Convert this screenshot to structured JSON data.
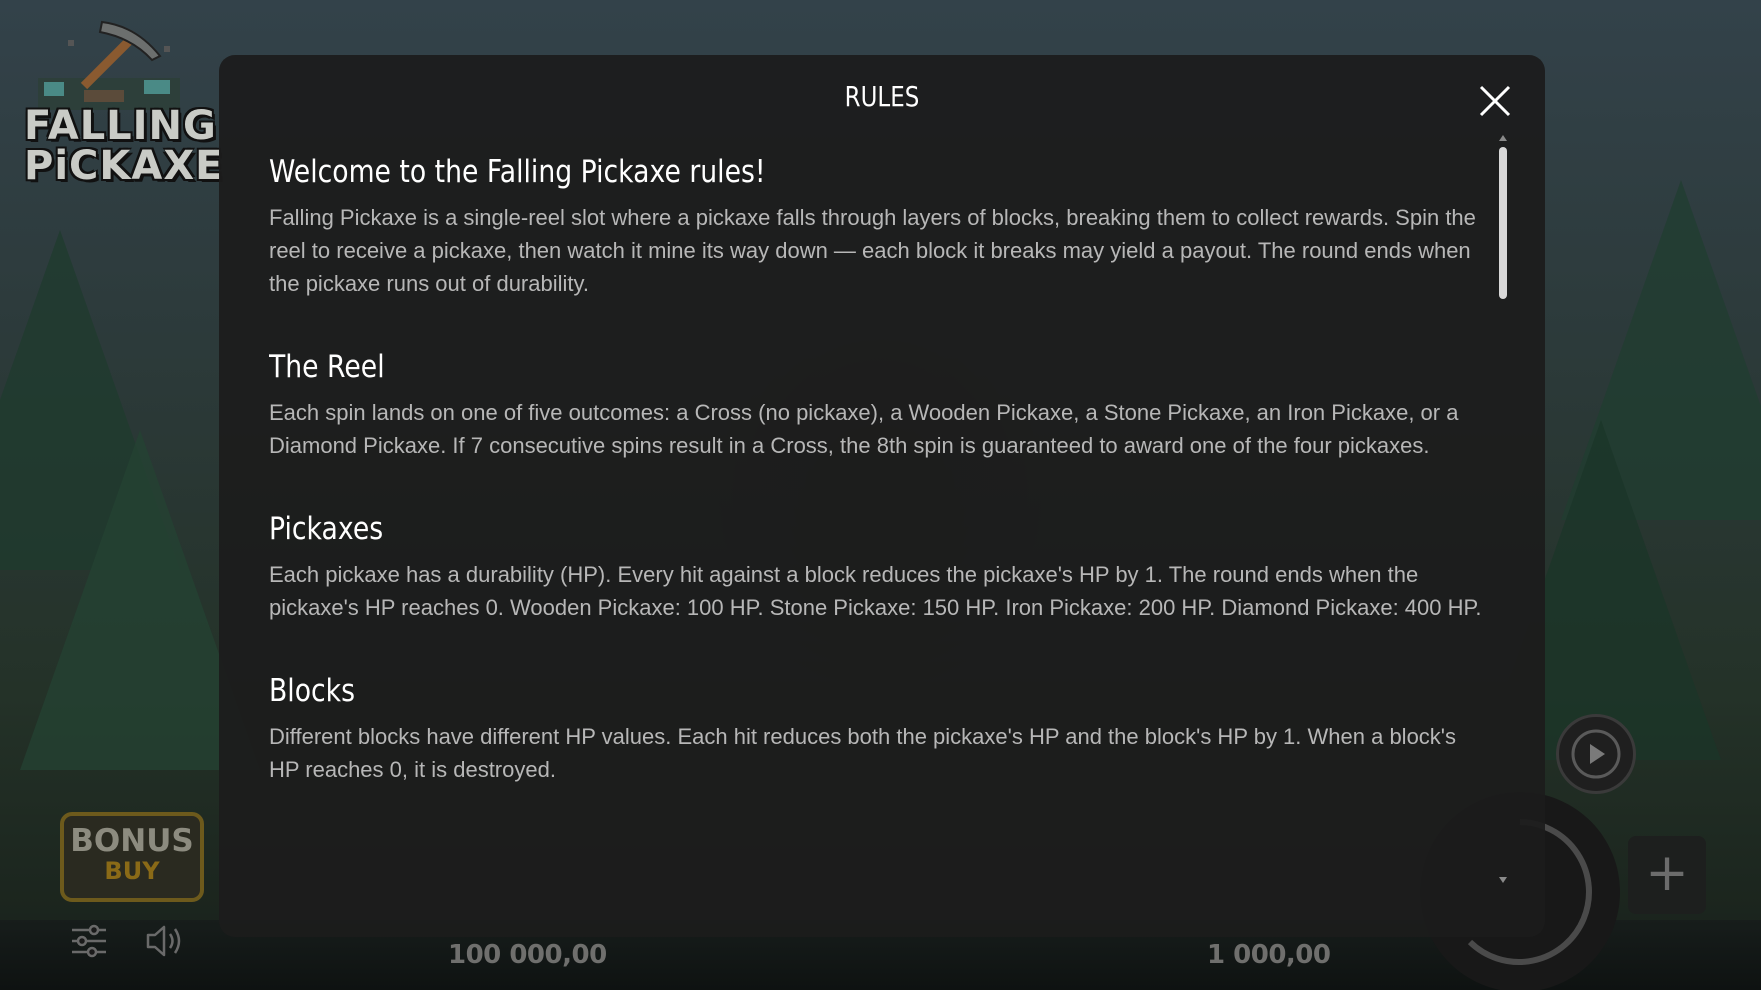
{
  "game": {
    "logo": {
      "line1": "FALLING",
      "line2": "PiCKAXE"
    },
    "bonus_buy": {
      "line1": "BONUS",
      "line2": "BUY"
    },
    "balance_left": "100 000,00",
    "balance_right": "1 000,00",
    "icons": {
      "settings": "sliders-icon",
      "sound": "speaker-icon",
      "autoplay": "play-icon",
      "spin": "spin-arc-icon",
      "plus": "plus-icon"
    },
    "plus_label": "+"
  },
  "modal": {
    "title": "RULES",
    "close_icon": "close-icon",
    "sections": [
      {
        "heading": "Welcome to the Falling Pickaxe rules!",
        "text": "Falling Pickaxe is a single-reel slot where a pickaxe falls through layers of blocks, breaking them to collect rewards. Spin the reel to receive a pickaxe, then watch it mine its way down — each block it breaks may yield a payout. The round ends when the pickaxe runs out of durability."
      },
      {
        "heading": "The Reel",
        "text": "Each spin lands on one of five outcomes: a Cross (no pickaxe), a Wooden Pickaxe, a Stone Pickaxe, an Iron Pickaxe, or a Diamond Pickaxe. If 7 consecutive spins result in a Cross, the 8th spin is guaranteed to award one of the four pickaxes."
      },
      {
        "heading": "Pickaxes",
        "text": "Each pickaxe has a durability (HP). Every hit against a block reduces the pickaxe's HP by 1. The round ends when the pickaxe's HP reaches 0. Wooden Pickaxe: 100 HP. Stone Pickaxe: 150 HP. Iron Pickaxe: 200 HP. Diamond Pickaxe: 400 HP."
      },
      {
        "heading": "Blocks",
        "text": "Different blocks have different HP values. Each hit reduces both the pickaxe's HP and the block's HP by 1. When a block's HP reaches 0, it is destroyed."
      }
    ]
  },
  "colors": {
    "modal_bg": "#1c1c1c",
    "heading": "#ffffff",
    "body_text": "#b7b7b7",
    "bonus_gold": "#8a6a17"
  }
}
